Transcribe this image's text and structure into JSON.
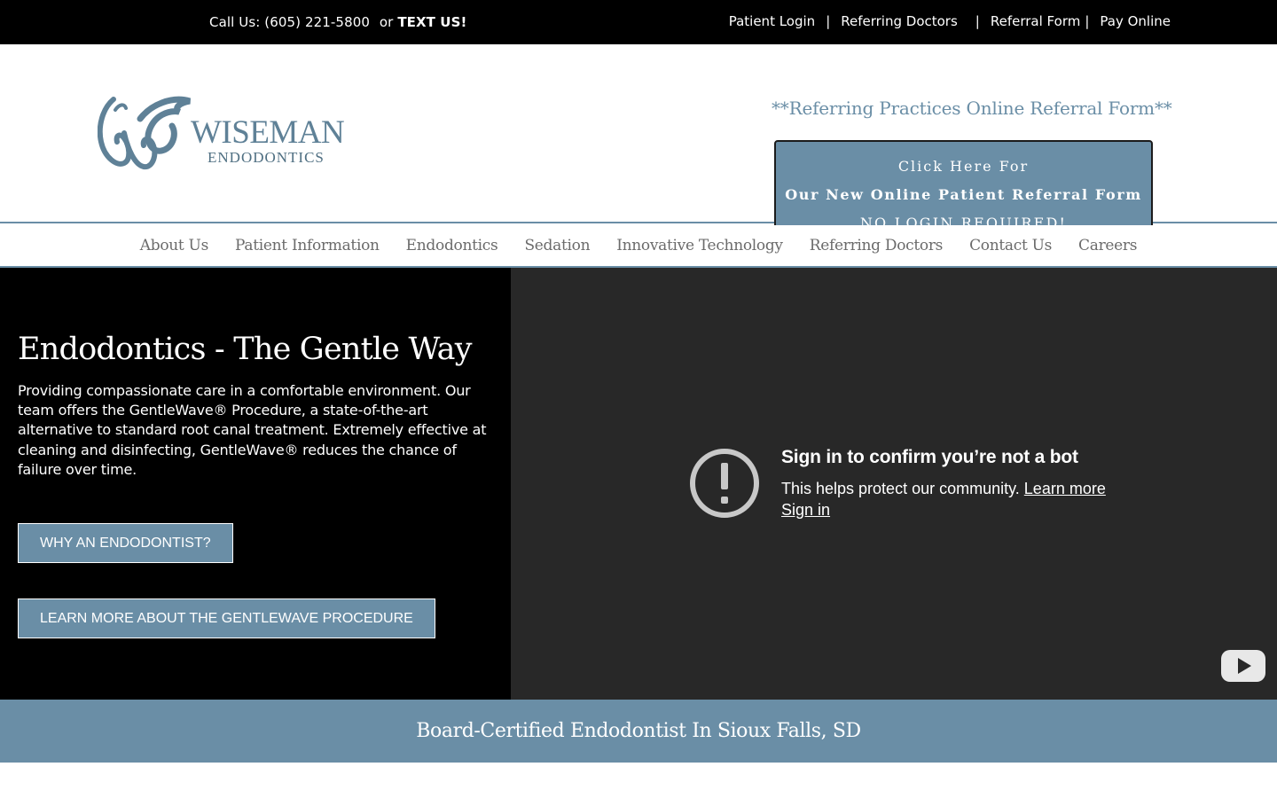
{
  "topbar": {
    "call_text": "Call Us: (605) 221-5800",
    "or_text": "or",
    "text_us": "TEXT US!",
    "links": [
      {
        "label": "Patient Login"
      },
      {
        "label": "Referring Doctors"
      },
      {
        "label": "Referral Form"
      },
      {
        "label": "Pay Online"
      }
    ],
    "separator": "|"
  },
  "header": {
    "logo": {
      "brand": "WISEMAN",
      "sub": "ENDODONTICS",
      "color": "#5f8197"
    },
    "referral_heading": "**Referring Practices Online Referral Form**",
    "referral_box": {
      "line1": "Click Here For",
      "line2": "Our New Online Patient Referral Form",
      "line3": "NO LOGIN REQUIRED!"
    }
  },
  "nav": {
    "items": [
      {
        "label": "About Us"
      },
      {
        "label": "Patient Information"
      },
      {
        "label": "Endodontics"
      },
      {
        "label": "Sedation"
      },
      {
        "label": "Innovative Technology"
      },
      {
        "label": "Referring Doctors"
      },
      {
        "label": "Contact Us"
      },
      {
        "label": "Careers"
      }
    ]
  },
  "hero": {
    "title": "Endodontics - The Gentle Way",
    "description": "Providing compassionate care in a comfortable environment. Our team offers the GentleWave® Procedure, a state-of-the-art alternative to standard root canal treatment. Extremely effective at cleaning and disinfecting, GentleWave® reduces the chance of failure over time.",
    "buttons": [
      {
        "label": "WHY AN ENDODONTIST?"
      },
      {
        "label": "LEARN MORE ABOUT THE GENTLEWAVE PROCEDURE"
      }
    ]
  },
  "video": {
    "title": "Sign in to confirm you’re not a bot",
    "message": "This helps protect our community.",
    "learn_more": "Learn more",
    "sign_in": "Sign in",
    "icons": {
      "alert": "alert-circle-icon",
      "player": "youtube-icon"
    }
  },
  "band": {
    "text": "Board-Certified Endodontist In Sioux Falls, SD"
  },
  "colors": {
    "accent": "#6a8ea6",
    "black": "#000000",
    "video_bg": "#282828"
  }
}
